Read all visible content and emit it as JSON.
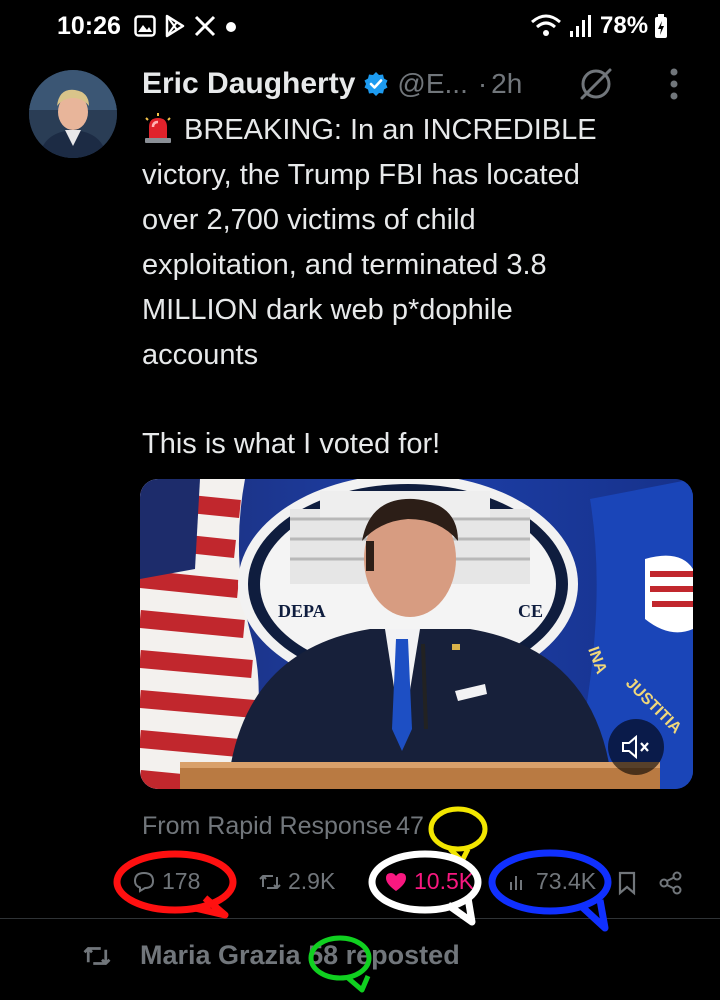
{
  "status_bar": {
    "time": "10:26",
    "battery": "78%",
    "icons_left": [
      "gallery-icon",
      "play-store-icon",
      "x-icon",
      "notification-dot"
    ],
    "icons_right": [
      "wifi-icon",
      "signal-icon",
      "battery-icon"
    ]
  },
  "tweet": {
    "author_name": "Eric Daugherty",
    "handle": "@E...",
    "separator": "·",
    "time_ago": "2h",
    "text_lines": [
      "BREAKING: In an INCREDIBLE",
      "victory, the Trump FBI has located",
      "over 2,700 victims of child",
      "exploitation, and terminated 3.8",
      "MILLION dark web p*dophile",
      "accounts"
    ],
    "text_second": "This is what I voted for!",
    "media": {
      "seal_text_top": "DEPA",
      "seal_text_right": "CE",
      "flag_text_1": "INA",
      "flag_text_2": "JUSTITIA"
    },
    "source_label": "From Rapid Response",
    "source_count": "47",
    "actions": {
      "replies": "178",
      "reposts": "2.9K",
      "likes": "10.5K",
      "views": "73.4K"
    }
  },
  "repost_row": {
    "name": "Maria Grazia",
    "count": "58",
    "suffix": "reposted"
  },
  "colors": {
    "background": "#000000",
    "text": "#e7e9ea",
    "muted": "#71767b",
    "like": "#f91880",
    "verified": "#1d9bf0",
    "annotation_yellow": "#f2e600",
    "annotation_red": "#ff1010",
    "annotation_white": "#ffffff",
    "annotation_blue": "#1030ff",
    "annotation_green": "#10d020"
  }
}
